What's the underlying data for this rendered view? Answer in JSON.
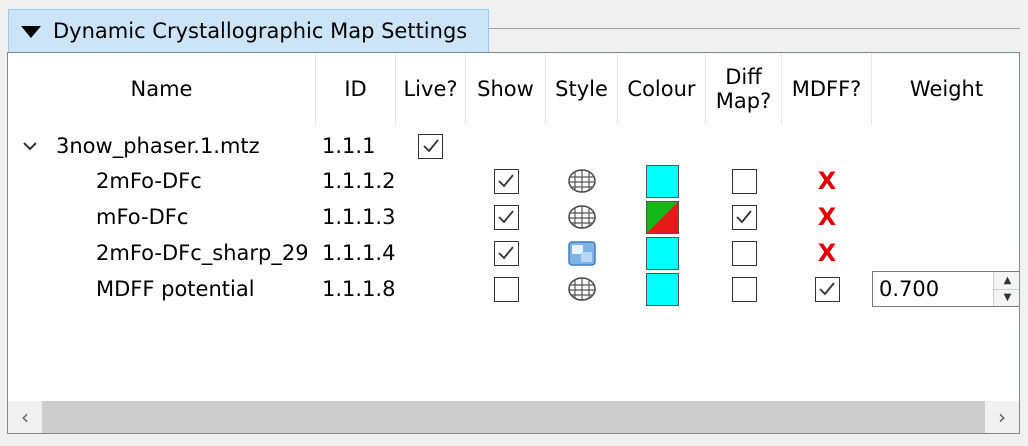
{
  "group": {
    "title": "Dynamic Crystallographic Map Settings",
    "expanded": true
  },
  "columns": {
    "name": "Name",
    "id": "ID",
    "live": "Live?",
    "show": "Show",
    "style": "Style",
    "colour": "Colour",
    "diff_line1": "Diff",
    "diff_line2": "Map?",
    "mdff": "MDFF?",
    "weight": "Weight"
  },
  "parent": {
    "name": "3now_phaser.1.mtz",
    "id": "1.1.1",
    "live": true,
    "expanded": true
  },
  "maps": [
    {
      "name": "2mFo-DFc",
      "id": "1.1.1.2",
      "show": true,
      "style": "mesh-icon",
      "colour": "#00ffff",
      "diff_map": false,
      "mdff": "x",
      "mdff_symbol": "X"
    },
    {
      "name": "mFo-DFc",
      "id": "1.1.1.3",
      "show": true,
      "style": "mesh-icon",
      "colour": "green-red",
      "diff_map": true,
      "mdff": "x",
      "mdff_symbol": "X"
    },
    {
      "name": "2mFo-DFc_sharp_29",
      "id": "1.1.1.4",
      "show": true,
      "style": "solid-surface-icon",
      "colour": "#00ffff",
      "diff_map": false,
      "mdff": "x",
      "mdff_symbol": "X"
    },
    {
      "name": "MDFF potential",
      "id": "1.1.1.8",
      "show": false,
      "style": "mesh-icon",
      "colour": "#00ffff",
      "diff_map": false,
      "mdff": true,
      "weight": "0.700"
    }
  ]
}
